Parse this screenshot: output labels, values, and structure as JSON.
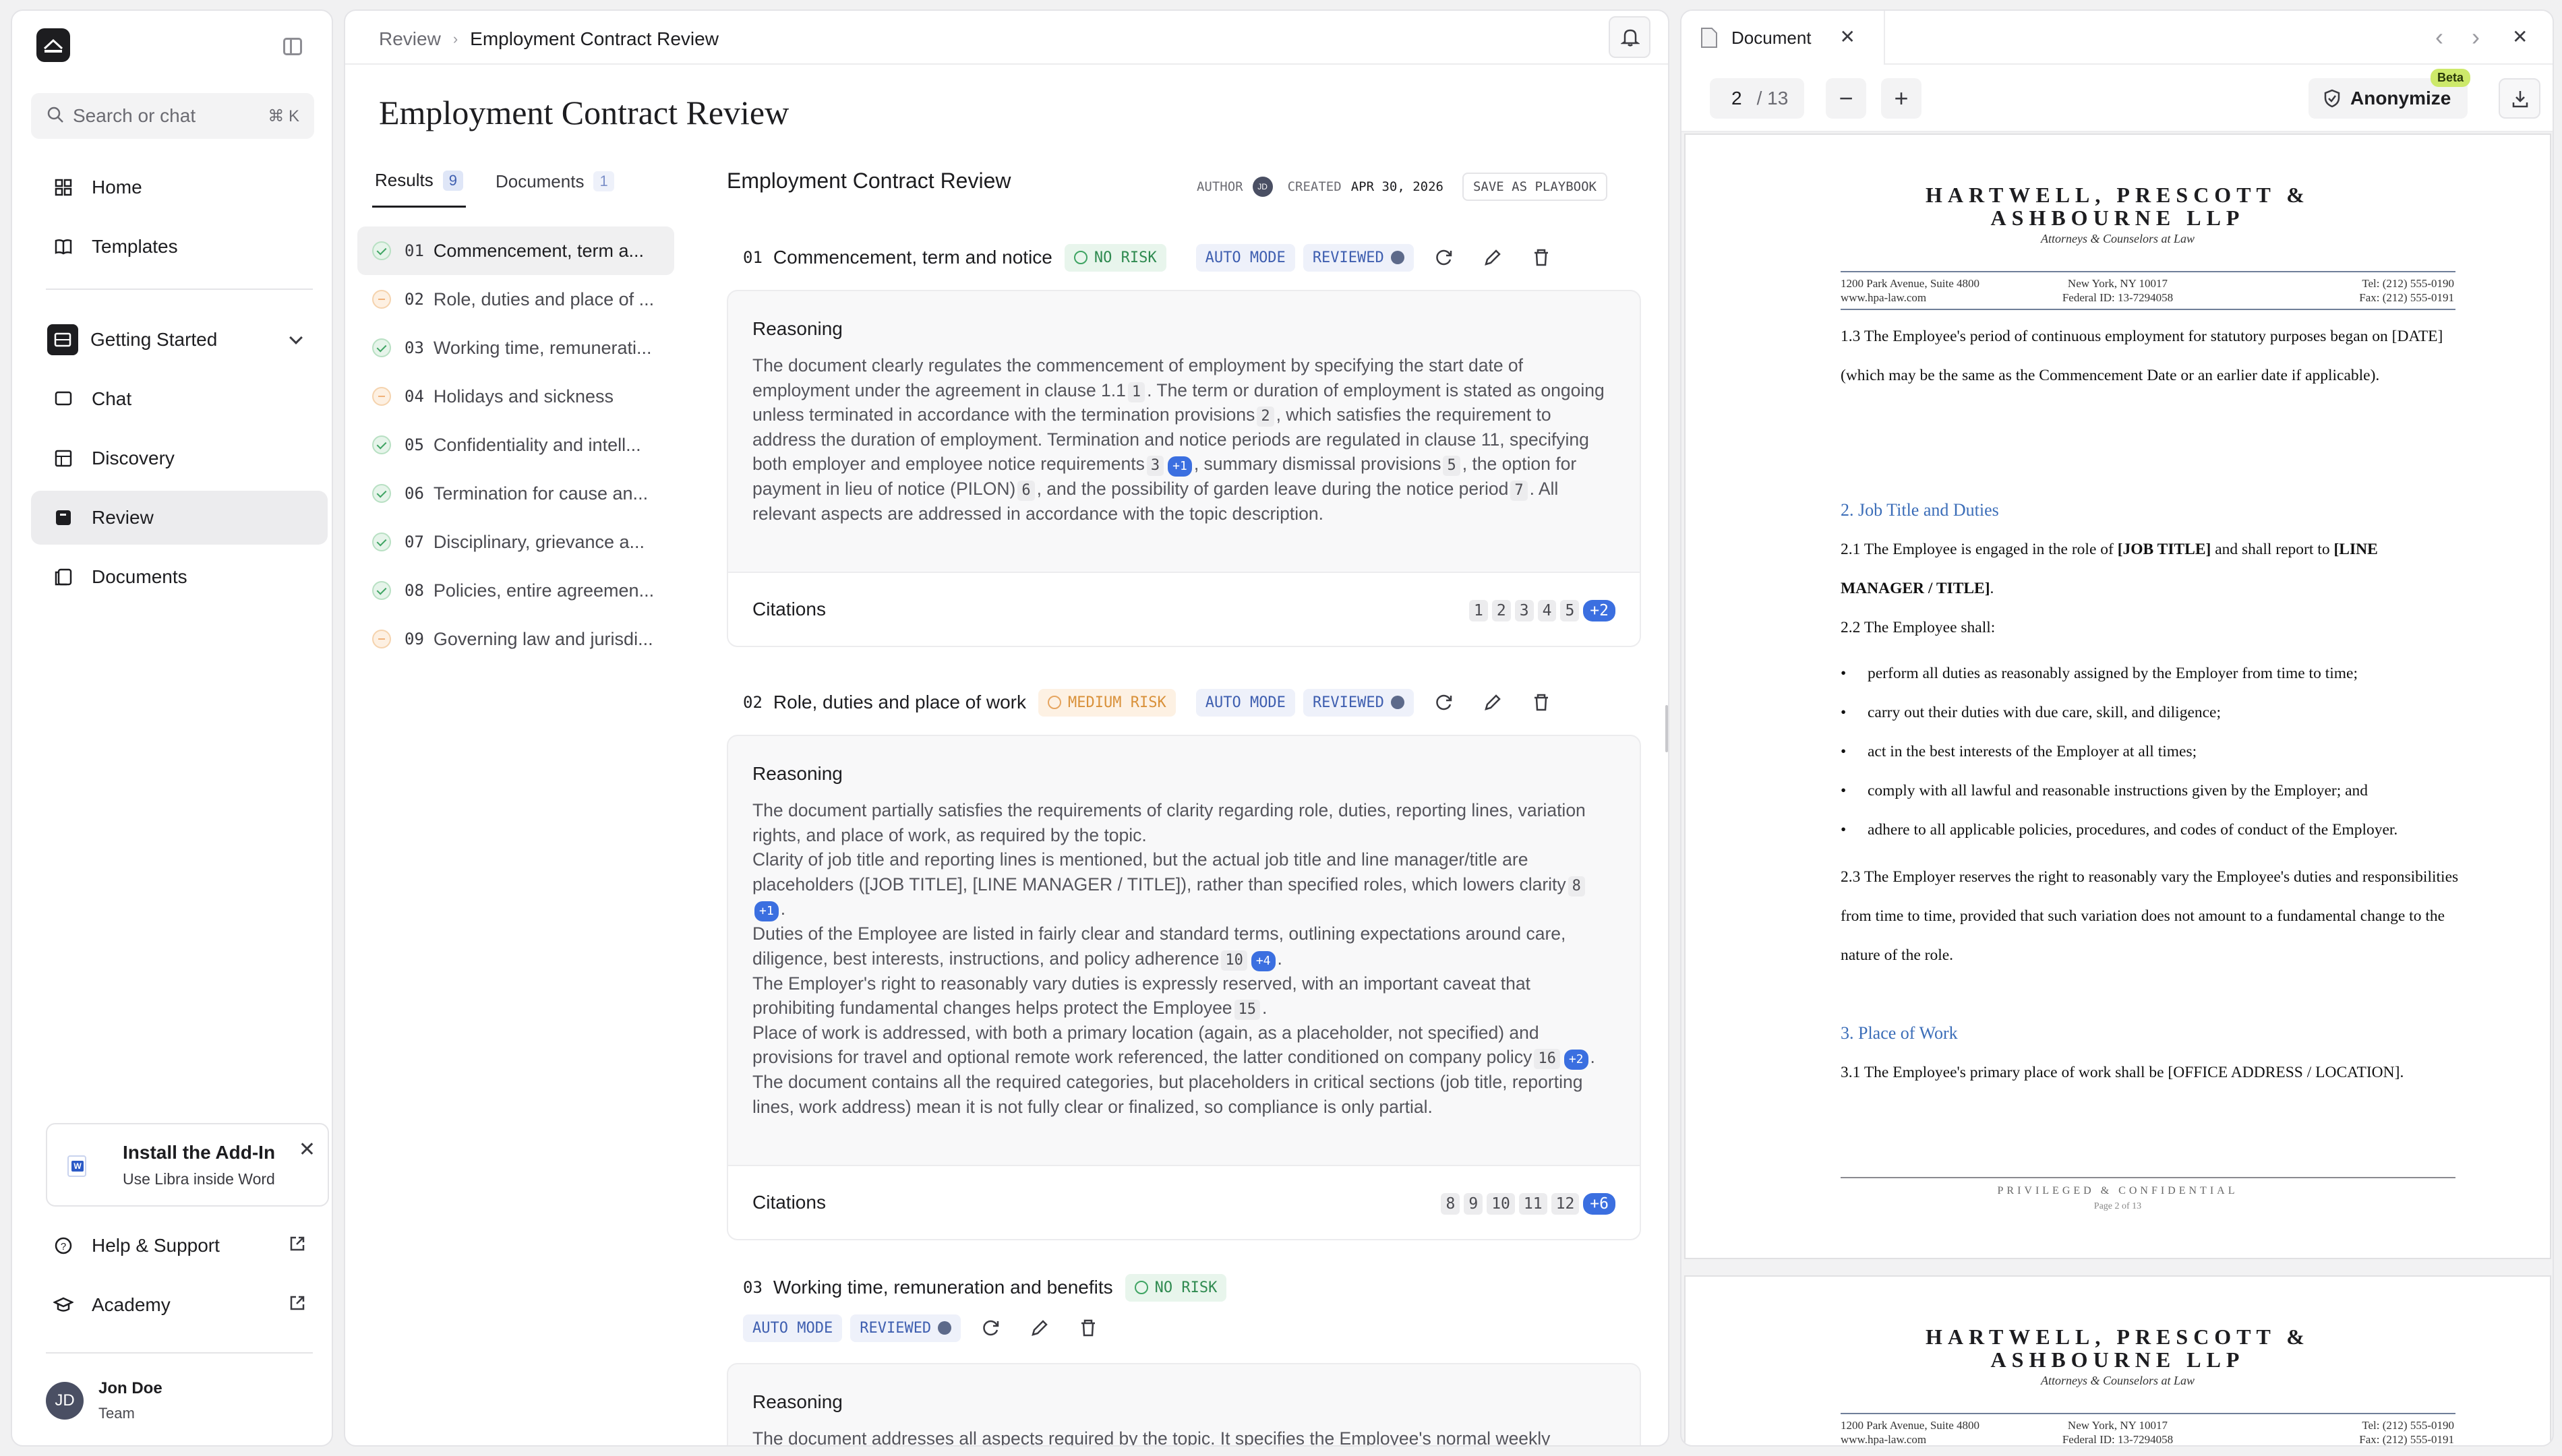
{
  "sidebar": {
    "search_placeholder": "Search or chat",
    "search_shortcut": "⌘ K",
    "nav_top": [
      {
        "label": "Home",
        "icon": "home-icon"
      },
      {
        "label": "Templates",
        "icon": "book-icon"
      }
    ],
    "workspace": "Getting Started",
    "nav_ws": [
      {
        "label": "Chat",
        "icon": "chat-icon"
      },
      {
        "label": "Discovery",
        "icon": "grid-icon"
      },
      {
        "label": "Review",
        "icon": "review-icon"
      },
      {
        "label": "Documents",
        "icon": "documents-icon"
      }
    ],
    "addin": {
      "title": "Install the Add-In",
      "subtitle": "Use Libra inside Word"
    },
    "bottom": [
      {
        "label": "Help & Support"
      },
      {
        "label": "Academy"
      }
    ],
    "user": {
      "initials": "JD",
      "name": "Jon Doe",
      "team": "Team"
    }
  },
  "header": {
    "crumb_root": "Review",
    "crumb_current": "Employment Contract Review",
    "page_title": "Employment Contract Review"
  },
  "tabs": [
    {
      "label": "Results",
      "count": "9"
    },
    {
      "label": "Documents",
      "count": "1"
    }
  ],
  "result_list": [
    {
      "num": "01",
      "label": "Commencement, term a...",
      "status": "ok"
    },
    {
      "num": "02",
      "label": "Role, duties and place of ...",
      "status": "medium"
    },
    {
      "num": "03",
      "label": "Working time, remunerati...",
      "status": "ok"
    },
    {
      "num": "04",
      "label": "Holidays and sickness",
      "status": "medium"
    },
    {
      "num": "05",
      "label": "Confidentiality and intell...",
      "status": "ok"
    },
    {
      "num": "06",
      "label": "Termination for cause an...",
      "status": "ok"
    },
    {
      "num": "07",
      "label": "Disciplinary, grievance a...",
      "status": "ok"
    },
    {
      "num": "08",
      "label": "Policies, entire agreemen...",
      "status": "ok"
    },
    {
      "num": "09",
      "label": "Governing law and jurisdi...",
      "status": "medium"
    }
  ],
  "results": {
    "title": "Employment Contract Review",
    "author_label": "AUTHOR",
    "author_initials": "JD",
    "created_label": "CREATED",
    "created_value": "APR 30, 2026",
    "save_playbook": "SAVE AS PLAYBOOK",
    "auto_mode": "AUTO MODE",
    "reviewed": "REVIEWED",
    "reasoning_label": "Reasoning",
    "citations_label": "Citations",
    "items": [
      {
        "num": "01",
        "title": "Commencement, term and notice",
        "risk": "NO RISK",
        "reasoning": [
          {
            "t": "The document clearly regulates the commencement of employment by specifying the start date of employment under the agreement in clause 1.1"
          },
          {
            "ref": "1"
          },
          {
            "t": ". The term or duration of employment is stated as ongoing unless terminated in accordance with the termination provisions"
          },
          {
            "ref": "2"
          },
          {
            "t": ", which satisfies the requirement to address the duration of employment. Termination and notice periods are regulated in clause 11, specifying both employer and employee notice requirements"
          },
          {
            "ref": "3"
          },
          {
            "plus": "+1"
          },
          {
            "t": ", summary dismissal provisions"
          },
          {
            "ref": "5"
          },
          {
            "t": ", the option for payment in lieu of notice (PILON)"
          },
          {
            "ref": "6"
          },
          {
            "t": ", and the possibility of garden leave during the notice period"
          },
          {
            "ref": "7"
          },
          {
            "t": ". All relevant aspects are addressed in accordance with the topic description."
          }
        ],
        "citations": [
          "1",
          "2",
          "3",
          "4",
          "5"
        ],
        "citations_more": "+2"
      },
      {
        "num": "02",
        "title": "Role, duties and place of work",
        "risk": "MEDIUM RISK",
        "paragraphs": [
          [
            {
              "t": "The document partially satisfies the requirements of clarity regarding role, duties, reporting lines, variation rights, and place of work, as required by the topic."
            }
          ],
          [
            {
              "t": "Clarity of job title and reporting lines is mentioned, but the actual job title and line manager/title are placeholders ([JOB TITLE], [LINE MANAGER / TITLE]), rather than specified roles, which lowers clarity"
            },
            {
              "ref": "8"
            },
            {
              "plus": "+1"
            },
            {
              "t": "."
            }
          ],
          [
            {
              "t": "Duties of the Employee are listed in fairly clear and standard terms, outlining expectations around care, diligence, best interests, instructions, and policy adherence"
            },
            {
              "ref": "10"
            },
            {
              "plus": "+4"
            },
            {
              "t": "."
            }
          ],
          [
            {
              "t": "The Employer's right to reasonably vary duties is expressly reserved, with an important caveat that prohibiting fundamental changes helps protect the Employee"
            },
            {
              "ref": "15"
            },
            {
              "t": "."
            }
          ],
          [
            {
              "t": "Place of work is addressed, with both a primary location (again, as a placeholder, not specified) and provisions for travel and optional remote work referenced, the latter conditioned on company policy"
            },
            {
              "ref": "16"
            },
            {
              "plus": "+2"
            },
            {
              "t": "."
            }
          ],
          [
            {
              "t": "The document contains all the required categories, but placeholders in critical sections (job title, reporting lines, work address) mean it is not fully clear or finalized, so compliance is only partial."
            }
          ]
        ],
        "citations": [
          "8",
          "9",
          "10",
          "11",
          "12"
        ],
        "citations_more": "+6"
      },
      {
        "num": "03",
        "title": "Working time, remuneration and benefits",
        "risk": "NO RISK",
        "reasoning_preview": "The document addresses all aspects required by the topic. It specifies the Employee's normal weekly"
      }
    ]
  },
  "document": {
    "tab_title": "Document",
    "page_current": "2",
    "page_total": "/ 13",
    "anonymize": "Anonymize",
    "beta": "Beta",
    "firm_line1": "HARTWELL, PRESCOTT &",
    "firm_line2": "ASHBOURNE LLP",
    "firm_sub": "Attorneys & Counselors at Law",
    "addr_l1": "1200 Park Avenue, Suite 4800",
    "addr_l2": "www.hpa-law.com",
    "addr_c1": "New York, NY 10017",
    "addr_c2": "Federal ID: 13-7294058",
    "addr_r1": "Tel: (212) 555-0190",
    "addr_r2": "Fax: (212) 555-0191",
    "p13": "1.3 The Employee's period of continuous employment for statutory purposes began on [DATE] (which may be the same as the Commencement Date or an earlier date if applicable).",
    "h2": "2. Job Title and Duties",
    "p21_a": "2.1 The Employee is engaged in the role of ",
    "p21_b": "[JOB TITLE]",
    "p21_c": " and shall report to ",
    "p21_d": "[LINE MANAGER / TITLE]",
    "p21_e": ".",
    "p22": "2.2 The Employee shall:",
    "bullets": [
      "perform all duties as reasonably assigned by the Employer from time to time;",
      "carry out their duties with due care, skill, and diligence;",
      "act in the best interests of the Employer at all times;",
      "comply with all lawful and reasonable instructions given by the Employer; and",
      "adhere to all applicable policies, procedures, and codes of conduct of the Employer."
    ],
    "p23": "2.3 The Employer reserves the right to reasonably vary the Employee's duties and responsibilities from time to time, provided that such variation does not amount to a fundamental change to the nature of the role.",
    "h3": "3. Place of Work",
    "p31": "3.1 The Employee's primary place of work shall be [OFFICE ADDRESS / LOCATION].",
    "footer": "PRIVILEGED & CONFIDENTIAL",
    "footer_page": "Page 2 of 13"
  }
}
